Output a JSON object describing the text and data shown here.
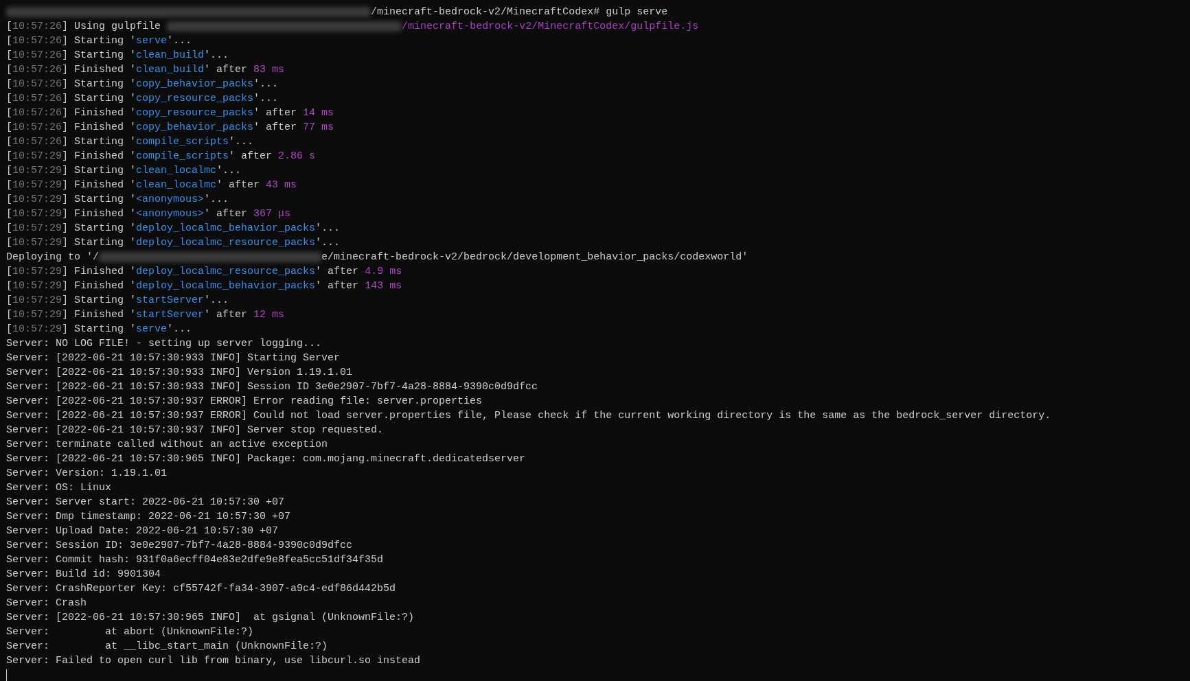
{
  "terminal": {
    "lines": [
      {
        "segments": [
          {
            "kind": "redacted"
          },
          {
            "kind": "plain",
            "text": "/minecraft-bedrock-v2/MinecraftCodex# gulp serve"
          }
        ]
      },
      {
        "segments": [
          {
            "kind": "plain",
            "text": "["
          },
          {
            "kind": "stamp",
            "text": "10:57:26"
          },
          {
            "kind": "plain",
            "text": "] Using gulpfile "
          },
          {
            "kind": "redacted"
          },
          {
            "kind": "path",
            "text": "/minecraft-bedrock-v2/MinecraftCodex/gulpfile.js"
          }
        ]
      },
      {
        "segments": [
          {
            "kind": "plain",
            "text": "["
          },
          {
            "kind": "stamp",
            "text": "10:57:26"
          },
          {
            "kind": "plain",
            "text": "] Starting '"
          },
          {
            "kind": "task",
            "text": "serve"
          },
          {
            "kind": "plain",
            "text": "'..."
          }
        ]
      },
      {
        "segments": [
          {
            "kind": "plain",
            "text": "["
          },
          {
            "kind": "stamp",
            "text": "10:57:26"
          },
          {
            "kind": "plain",
            "text": "] Starting '"
          },
          {
            "kind": "task",
            "text": "clean_build"
          },
          {
            "kind": "plain",
            "text": "'..."
          }
        ]
      },
      {
        "segments": [
          {
            "kind": "plain",
            "text": "["
          },
          {
            "kind": "stamp",
            "text": "10:57:26"
          },
          {
            "kind": "plain",
            "text": "] Finished '"
          },
          {
            "kind": "task",
            "text": "clean_build"
          },
          {
            "kind": "plain",
            "text": "' after "
          },
          {
            "kind": "duration",
            "text": "83 ms"
          }
        ]
      },
      {
        "segments": [
          {
            "kind": "plain",
            "text": "["
          },
          {
            "kind": "stamp",
            "text": "10:57:26"
          },
          {
            "kind": "plain",
            "text": "] Starting '"
          },
          {
            "kind": "task",
            "text": "copy_behavior_packs"
          },
          {
            "kind": "plain",
            "text": "'..."
          }
        ]
      },
      {
        "segments": [
          {
            "kind": "plain",
            "text": "["
          },
          {
            "kind": "stamp",
            "text": "10:57:26"
          },
          {
            "kind": "plain",
            "text": "] Starting '"
          },
          {
            "kind": "task",
            "text": "copy_resource_packs"
          },
          {
            "kind": "plain",
            "text": "'..."
          }
        ]
      },
      {
        "segments": [
          {
            "kind": "plain",
            "text": "["
          },
          {
            "kind": "stamp",
            "text": "10:57:26"
          },
          {
            "kind": "plain",
            "text": "] Finished '"
          },
          {
            "kind": "task",
            "text": "copy_resource_packs"
          },
          {
            "kind": "plain",
            "text": "' after "
          },
          {
            "kind": "duration",
            "text": "14 ms"
          }
        ]
      },
      {
        "segments": [
          {
            "kind": "plain",
            "text": "["
          },
          {
            "kind": "stamp",
            "text": "10:57:26"
          },
          {
            "kind": "plain",
            "text": "] Finished '"
          },
          {
            "kind": "task",
            "text": "copy_behavior_packs"
          },
          {
            "kind": "plain",
            "text": "' after "
          },
          {
            "kind": "duration",
            "text": "77 ms"
          }
        ]
      },
      {
        "segments": [
          {
            "kind": "plain",
            "text": "["
          },
          {
            "kind": "stamp",
            "text": "10:57:26"
          },
          {
            "kind": "plain",
            "text": "] Starting '"
          },
          {
            "kind": "task",
            "text": "compile_scripts"
          },
          {
            "kind": "plain",
            "text": "'..."
          }
        ]
      },
      {
        "segments": [
          {
            "kind": "plain",
            "text": "["
          },
          {
            "kind": "stamp",
            "text": "10:57:29"
          },
          {
            "kind": "plain",
            "text": "] Finished '"
          },
          {
            "kind": "task",
            "text": "compile_scripts"
          },
          {
            "kind": "plain",
            "text": "' after "
          },
          {
            "kind": "duration",
            "text": "2.86 s"
          }
        ]
      },
      {
        "segments": [
          {
            "kind": "plain",
            "text": "["
          },
          {
            "kind": "stamp",
            "text": "10:57:29"
          },
          {
            "kind": "plain",
            "text": "] Starting '"
          },
          {
            "kind": "task",
            "text": "clean_localmc"
          },
          {
            "kind": "plain",
            "text": "'..."
          }
        ]
      },
      {
        "segments": [
          {
            "kind": "plain",
            "text": "["
          },
          {
            "kind": "stamp",
            "text": "10:57:29"
          },
          {
            "kind": "plain",
            "text": "] Finished '"
          },
          {
            "kind": "task",
            "text": "clean_localmc"
          },
          {
            "kind": "plain",
            "text": "' after "
          },
          {
            "kind": "duration",
            "text": "43 ms"
          }
        ]
      },
      {
        "segments": [
          {
            "kind": "plain",
            "text": "["
          },
          {
            "kind": "stamp",
            "text": "10:57:29"
          },
          {
            "kind": "plain",
            "text": "] Starting '"
          },
          {
            "kind": "task",
            "text": "<anonymous>"
          },
          {
            "kind": "plain",
            "text": "'..."
          }
        ]
      },
      {
        "segments": [
          {
            "kind": "plain",
            "text": "["
          },
          {
            "kind": "stamp",
            "text": "10:57:29"
          },
          {
            "kind": "plain",
            "text": "] Finished '"
          },
          {
            "kind": "task",
            "text": "<anonymous>"
          },
          {
            "kind": "plain",
            "text": "' after "
          },
          {
            "kind": "duration",
            "text": "367 μs"
          }
        ]
      },
      {
        "segments": [
          {
            "kind": "plain",
            "text": "["
          },
          {
            "kind": "stamp",
            "text": "10:57:29"
          },
          {
            "kind": "plain",
            "text": "] Starting '"
          },
          {
            "kind": "task",
            "text": "deploy_localmc_behavior_packs"
          },
          {
            "kind": "plain",
            "text": "'..."
          }
        ]
      },
      {
        "segments": [
          {
            "kind": "plain",
            "text": "["
          },
          {
            "kind": "stamp",
            "text": "10:57:29"
          },
          {
            "kind": "plain",
            "text": "] Starting '"
          },
          {
            "kind": "task",
            "text": "deploy_localmc_resource_packs"
          },
          {
            "kind": "plain",
            "text": "'..."
          }
        ]
      },
      {
        "segments": [
          {
            "kind": "plain",
            "text": "Deploying to '/"
          },
          {
            "kind": "redacted"
          },
          {
            "kind": "plain",
            "text": "e/minecraft-bedrock-v2/bedrock/development_behavior_packs/codexworld'"
          }
        ]
      },
      {
        "segments": [
          {
            "kind": "plain",
            "text": "["
          },
          {
            "kind": "stamp",
            "text": "10:57:29"
          },
          {
            "kind": "plain",
            "text": "] Finished '"
          },
          {
            "kind": "task",
            "text": "deploy_localmc_resource_packs"
          },
          {
            "kind": "plain",
            "text": "' after "
          },
          {
            "kind": "duration",
            "text": "4.9 ms"
          }
        ]
      },
      {
        "segments": [
          {
            "kind": "plain",
            "text": "["
          },
          {
            "kind": "stamp",
            "text": "10:57:29"
          },
          {
            "kind": "plain",
            "text": "] Finished '"
          },
          {
            "kind": "task",
            "text": "deploy_localmc_behavior_packs"
          },
          {
            "kind": "plain",
            "text": "' after "
          },
          {
            "kind": "duration",
            "text": "143 ms"
          }
        ]
      },
      {
        "segments": [
          {
            "kind": "plain",
            "text": "["
          },
          {
            "kind": "stamp",
            "text": "10:57:29"
          },
          {
            "kind": "plain",
            "text": "] Starting '"
          },
          {
            "kind": "task",
            "text": "startServer"
          },
          {
            "kind": "plain",
            "text": "'..."
          }
        ]
      },
      {
        "segments": [
          {
            "kind": "plain",
            "text": "["
          },
          {
            "kind": "stamp",
            "text": "10:57:29"
          },
          {
            "kind": "plain",
            "text": "] Finished '"
          },
          {
            "kind": "task",
            "text": "startServer"
          },
          {
            "kind": "plain",
            "text": "' after "
          },
          {
            "kind": "duration",
            "text": "12 ms"
          }
        ]
      },
      {
        "segments": [
          {
            "kind": "plain",
            "text": "["
          },
          {
            "kind": "stamp",
            "text": "10:57:29"
          },
          {
            "kind": "plain",
            "text": "] Starting '"
          },
          {
            "kind": "task",
            "text": "serve"
          },
          {
            "kind": "plain",
            "text": "'..."
          }
        ]
      },
      {
        "segments": [
          {
            "kind": "plain",
            "text": "Server: NO LOG FILE! - setting up server logging..."
          }
        ]
      },
      {
        "segments": [
          {
            "kind": "plain",
            "text": "Server: [2022-06-21 10:57:30:933 INFO] Starting Server"
          }
        ]
      },
      {
        "segments": [
          {
            "kind": "plain",
            "text": "Server: [2022-06-21 10:57:30:933 INFO] Version 1.19.1.01"
          }
        ]
      },
      {
        "segments": [
          {
            "kind": "plain",
            "text": "Server: [2022-06-21 10:57:30:933 INFO] Session ID 3e0e2907-7bf7-4a28-8884-9390c0d9dfcc"
          }
        ]
      },
      {
        "segments": [
          {
            "kind": "plain",
            "text": "Server: [2022-06-21 10:57:30:937 ERROR] Error reading file: server.properties"
          }
        ]
      },
      {
        "segments": [
          {
            "kind": "plain",
            "text": "Server: [2022-06-21 10:57:30:937 ERROR] Could not load server.properties file, Please check if the current working directory is the same as the bedrock_server directory."
          }
        ]
      },
      {
        "segments": [
          {
            "kind": "plain",
            "text": "Server: [2022-06-21 10:57:30:937 INFO] Server stop requested."
          }
        ]
      },
      {
        "segments": [
          {
            "kind": "plain",
            "text": "Server: terminate called without an active exception"
          }
        ]
      },
      {
        "segments": [
          {
            "kind": "plain",
            "text": "Server: [2022-06-21 10:57:30:965 INFO] Package: com.mojang.minecraft.dedicatedserver"
          }
        ]
      },
      {
        "segments": [
          {
            "kind": "plain",
            "text": "Server: Version: 1.19.1.01"
          }
        ]
      },
      {
        "segments": [
          {
            "kind": "plain",
            "text": "Server: OS: Linux"
          }
        ]
      },
      {
        "segments": [
          {
            "kind": "plain",
            "text": "Server: Server start: 2022-06-21 10:57:30 +07"
          }
        ]
      },
      {
        "segments": [
          {
            "kind": "plain",
            "text": "Server: Dmp timestamp: 2022-06-21 10:57:30 +07"
          }
        ]
      },
      {
        "segments": [
          {
            "kind": "plain",
            "text": "Server: Upload Date: 2022-06-21 10:57:30 +07"
          }
        ]
      },
      {
        "segments": [
          {
            "kind": "plain",
            "text": "Server: Session ID: 3e0e2907-7bf7-4a28-8884-9390c0d9dfcc"
          }
        ]
      },
      {
        "segments": [
          {
            "kind": "plain",
            "text": "Server: Commit hash: 931f0a6ecff04e83e2dfe9e8fea5cc51df34f35d"
          }
        ]
      },
      {
        "segments": [
          {
            "kind": "plain",
            "text": "Server: Build id: 9901304"
          }
        ]
      },
      {
        "segments": [
          {
            "kind": "plain",
            "text": "Server: CrashReporter Key: cf55742f-fa34-3907-a9c4-edf86d442b5d"
          }
        ]
      },
      {
        "segments": [
          {
            "kind": "plain",
            "text": "Server: Crash"
          }
        ]
      },
      {
        "segments": [
          {
            "kind": "plain",
            "text": "Server: [2022-06-21 10:57:30:965 INFO]  at gsignal (UnknownFile:?)"
          }
        ]
      },
      {
        "segments": [
          {
            "kind": "plain",
            "text": "Server:         at abort (UnknownFile:?)"
          }
        ]
      },
      {
        "segments": [
          {
            "kind": "plain",
            "text": "Server:         at __libc_start_main (UnknownFile:?)"
          }
        ]
      },
      {
        "segments": [
          {
            "kind": "plain",
            "text": "Server: Failed to open curl lib from binary, use libcurl.so instead"
          }
        ]
      }
    ],
    "cursor": true
  }
}
